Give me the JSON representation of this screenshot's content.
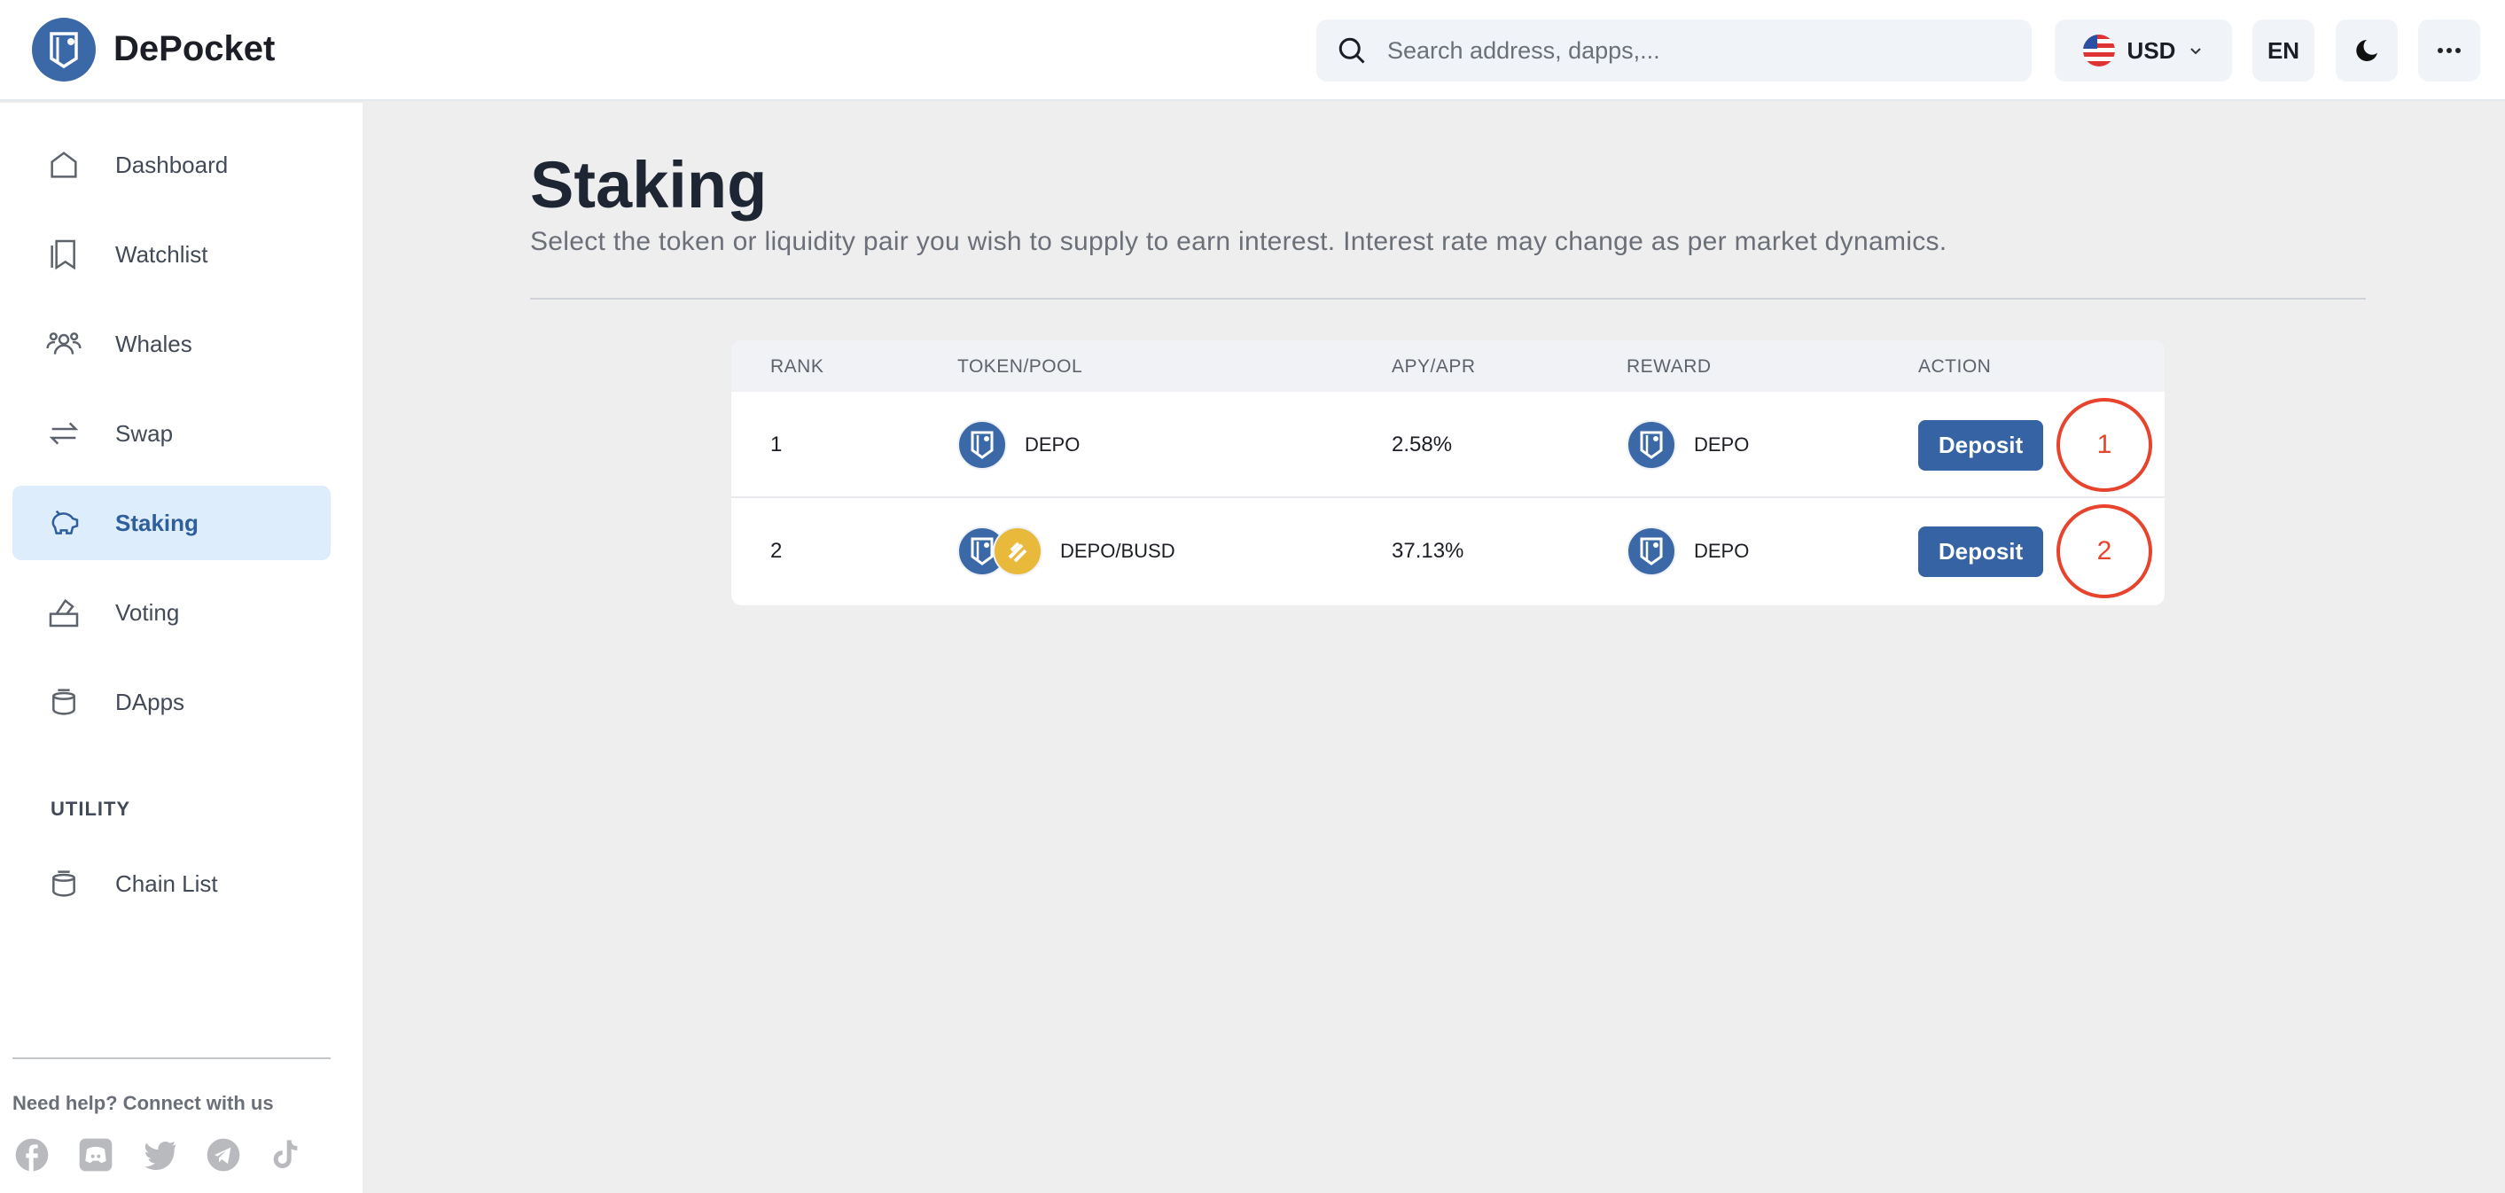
{
  "header": {
    "brand": "DePocket",
    "search_placeholder": "Search address, dapps,...",
    "currency": "USD",
    "language": "EN"
  },
  "sidebar": {
    "items": [
      {
        "label": "Dashboard"
      },
      {
        "label": "Watchlist"
      },
      {
        "label": "Whales"
      },
      {
        "label": "Swap"
      },
      {
        "label": "Staking"
      },
      {
        "label": "Voting"
      },
      {
        "label": "DApps"
      }
    ],
    "utility_heading": "UTILITY",
    "utility_items": [
      {
        "label": "Chain List"
      }
    ],
    "help_text": "Need help? Connect with us",
    "socials": [
      "facebook-icon",
      "discord-icon",
      "twitter-icon",
      "telegram-icon",
      "tiktok-icon"
    ]
  },
  "page": {
    "title": "Staking",
    "subtitle": "Select the token or liquidity pair you wish to supply to earn interest. Interest rate may change as per market dynamics."
  },
  "table": {
    "headers": [
      "RANK",
      "TOKEN/POOL",
      "APY/APR",
      "REWARD",
      "ACTION"
    ],
    "rows": [
      {
        "rank": "1",
        "token": "DEPO",
        "apy": "2.58%",
        "reward": "DEPO",
        "action": "Deposit",
        "marker": "1"
      },
      {
        "rank": "2",
        "token": "DEPO/BUSD",
        "apy": "37.13%",
        "reward": "DEPO",
        "action": "Deposit",
        "marker": "2"
      }
    ]
  },
  "colors": {
    "accent": "#3563a3",
    "marker": "#e8432d",
    "busd": "#e8b93a"
  }
}
